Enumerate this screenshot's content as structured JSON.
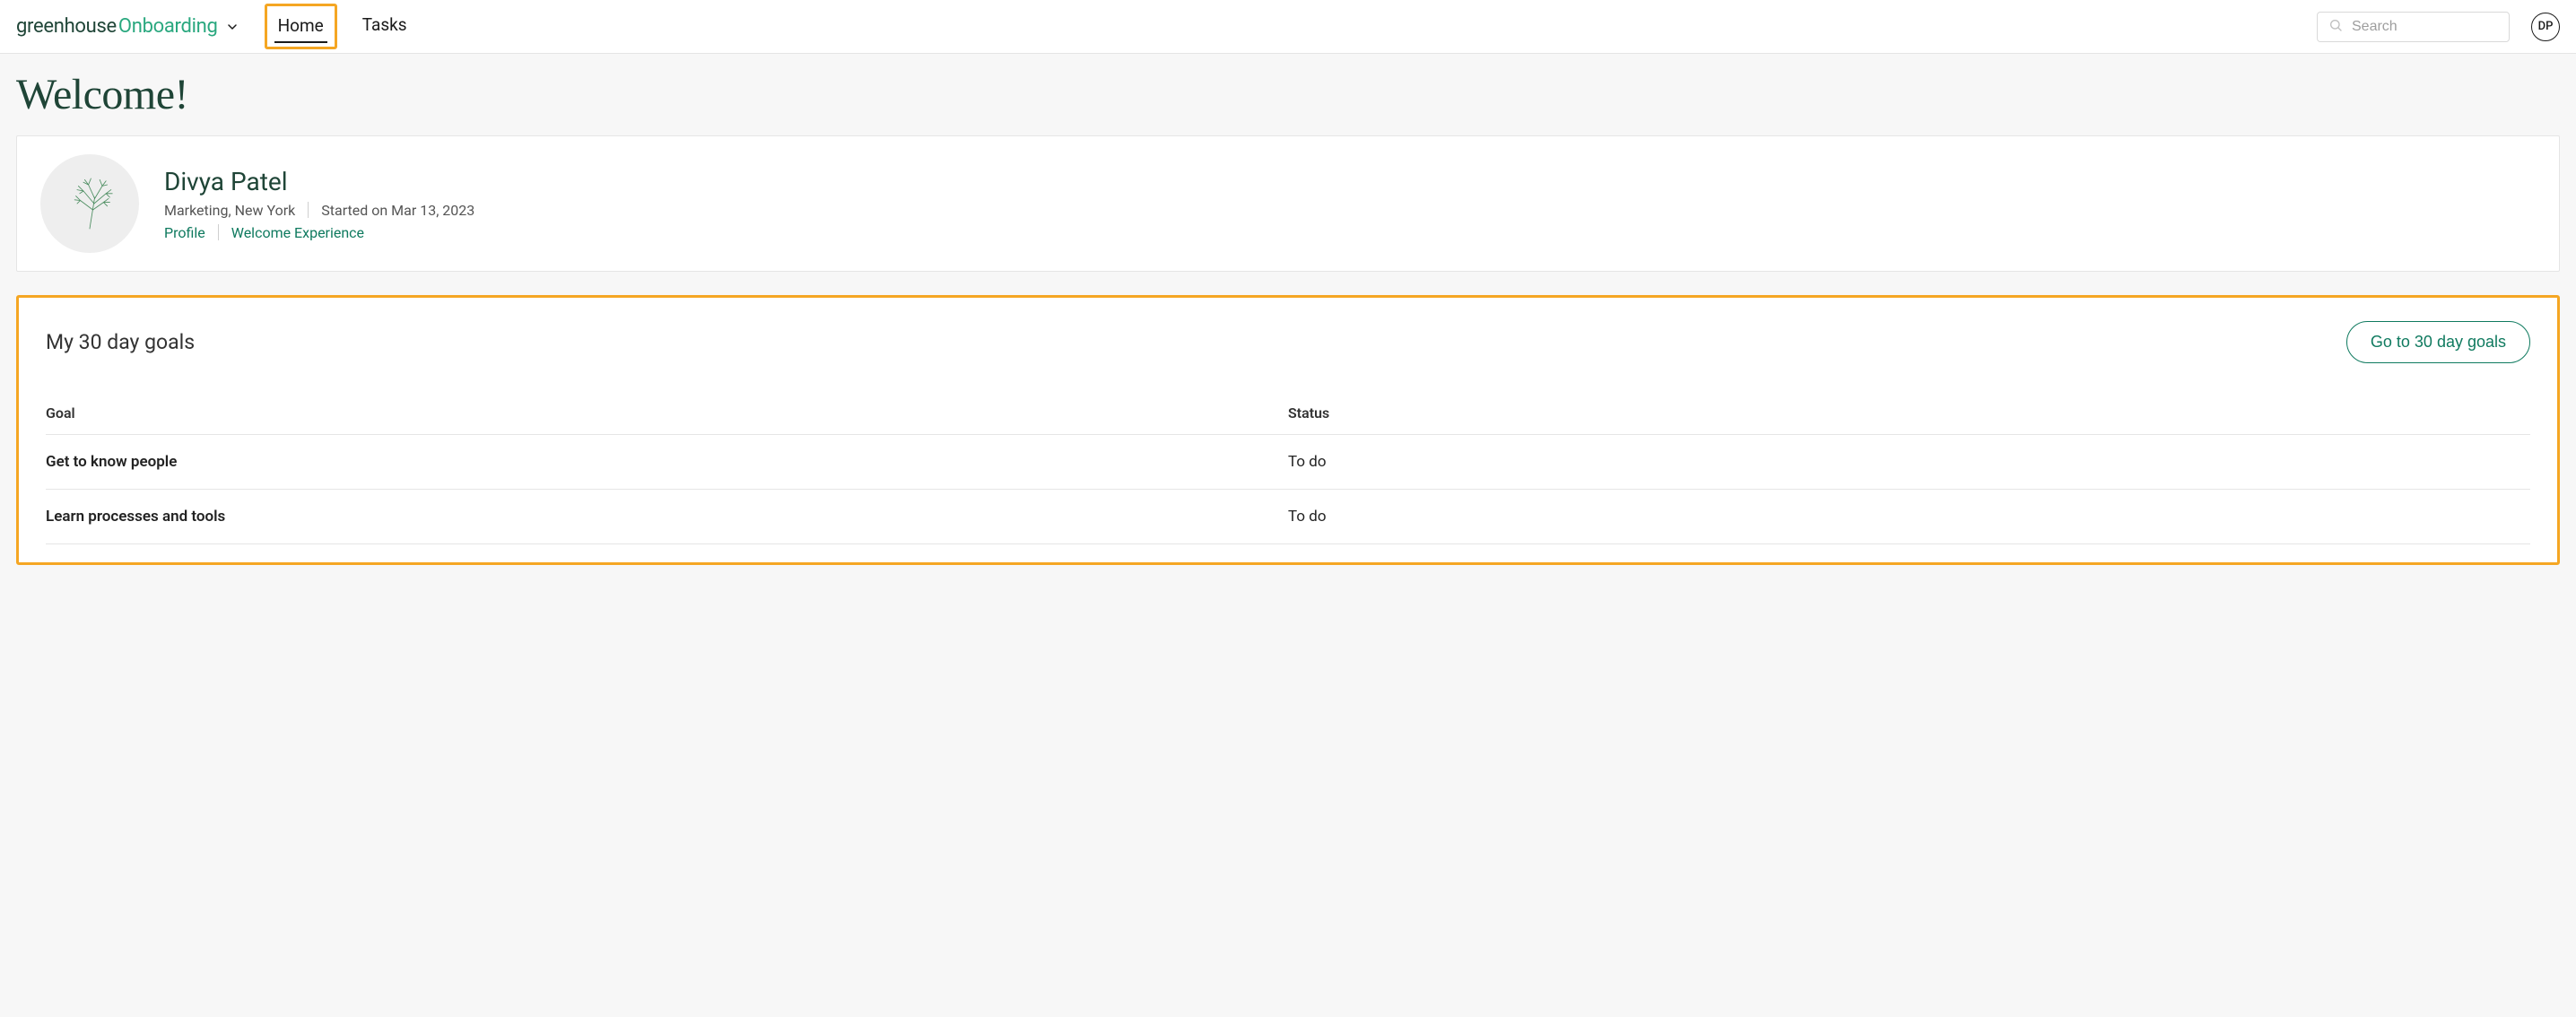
{
  "brand": {
    "part1": "greenhouse",
    "part2": "Onboarding"
  },
  "nav": {
    "home": "Home",
    "tasks": "Tasks"
  },
  "search": {
    "placeholder": "Search"
  },
  "user": {
    "initials": "DP"
  },
  "page": {
    "title": "Welcome!"
  },
  "profile": {
    "name": "Divya Patel",
    "dept_loc": "Marketing, New York",
    "started": "Started on Mar 13, 2023",
    "link_profile": "Profile",
    "link_welcome": "Welcome Experience"
  },
  "goals": {
    "title": "My 30 day goals",
    "button": "Go to 30 day goals",
    "col_goal": "Goal",
    "col_status": "Status",
    "rows": [
      {
        "name": "Get to know people",
        "status": "To do"
      },
      {
        "name": "Learn processes and tools",
        "status": "To do"
      }
    ]
  }
}
